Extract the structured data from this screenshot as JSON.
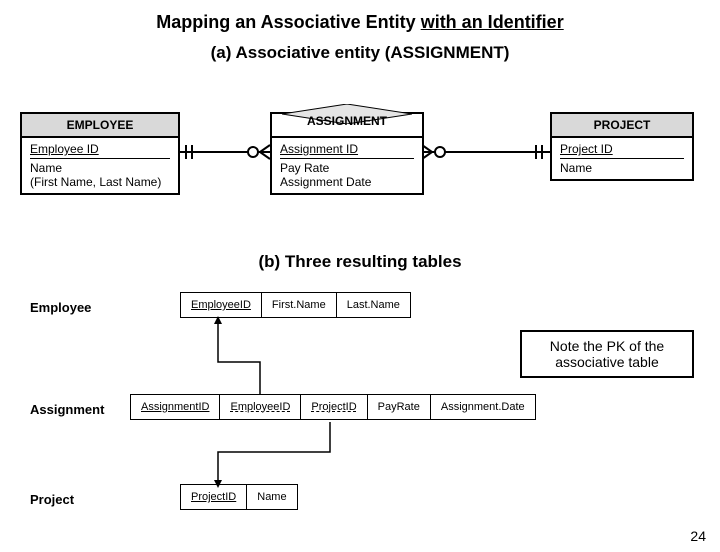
{
  "title_prefix": "Mapping an Associative Entity ",
  "title_suffix": "with an Identifier",
  "subtitle_a": "(a) Associative entity (ASSIGNMENT)",
  "subtitle_b": "(b) Three resulting tables",
  "employee": {
    "name": "EMPLOYEE",
    "pk": "Employee ID",
    "attr1": "Name",
    "attr2": " (First Name, Last Name)"
  },
  "assignment": {
    "name": "ASSIGNMENT",
    "pk": "Assignment ID",
    "attr1": "Pay Rate",
    "attr2": "Assignment Date"
  },
  "project": {
    "name": "PROJECT",
    "pk": "Project ID",
    "attr1": "Name"
  },
  "tbl_employee": {
    "label": "Employee",
    "c0": "EmployeeID",
    "c1": "First.Name",
    "c2": "Last.Name"
  },
  "tbl_assignment": {
    "label": "Assignment",
    "c0": "AssignmentID",
    "c1": "EmployeeID",
    "c2": "ProjectID",
    "c3": "PayRate",
    "c4": "Assignment.Date"
  },
  "tbl_project": {
    "label": "Project",
    "c0": "ProjectID",
    "c1": "Name"
  },
  "note": "Note the PK of the associative table",
  "page": "24"
}
